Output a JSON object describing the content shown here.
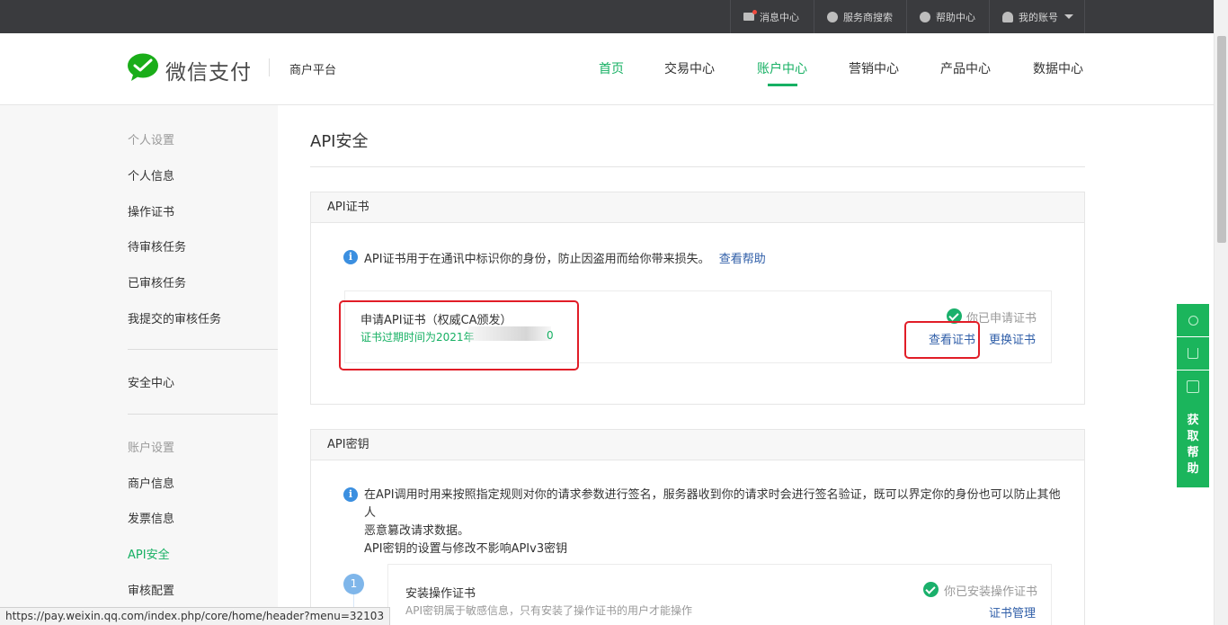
{
  "topbar": {
    "messages": "消息中心",
    "provider_search": "服务商搜索",
    "help_center": "帮助中心",
    "my_account": "我的账号"
  },
  "header": {
    "brand": "微信支付",
    "platform": "商户平台",
    "nav": [
      "首页",
      "交易中心",
      "账户中心",
      "营销中心",
      "产品中心",
      "数据中心"
    ],
    "active_nav": "账户中心"
  },
  "sidebar": {
    "personal_title": "个人设置",
    "personal_items": [
      "个人信息",
      "操作证书",
      "待审核任务",
      "已审核任务",
      "我提交的审核任务"
    ],
    "security": "安全中心",
    "account_title": "账户设置",
    "account_items": [
      "商户信息",
      "发票信息",
      "API安全",
      "审核配置"
    ],
    "active_item": "API安全"
  },
  "main": {
    "title": "API安全",
    "cert_panel": {
      "head": "API证书",
      "info": "API证书用于在通讯中标识你的身份，防止因盗用而给你带来损失。",
      "help_link": "查看帮助",
      "apply_title": "申请API证书（权威CA颁发）",
      "expiry": "证书过期时间为2021年",
      "expiry_tail": "0",
      "status": "你已申请证书",
      "view_link": "查看证书",
      "replace_link": "更换证书"
    },
    "key_panel": {
      "head": "API密钥",
      "info_line1": "在API调用时用来按照指定规则对你的请求参数进行签名，服务器收到你的请求时会进行签名验证，既可以界定你的身份也可以防止其他人",
      "info_line2": "恶意篡改请求数据。",
      "info_line3": "API密钥的设置与修改不影响APIv3密钥",
      "step_num": "1",
      "step_title": "安装操作证书",
      "step_desc": "API密钥属于敏感信息，只有安装了操作证书的用户才能操作",
      "step_status": "你已安装操作证书",
      "step_link": "证书管理"
    }
  },
  "float_bar": {
    "help": [
      "获",
      "取",
      "帮",
      "助"
    ]
  },
  "status_url": "https://pay.weixin.qq.com/index.php/core/home/header?menu=32103",
  "colors": {
    "brand_green": "#16b063",
    "link_blue": "#2f5ea8",
    "highlight_red": "#e11d27",
    "topbar": "#3a3b3e"
  }
}
